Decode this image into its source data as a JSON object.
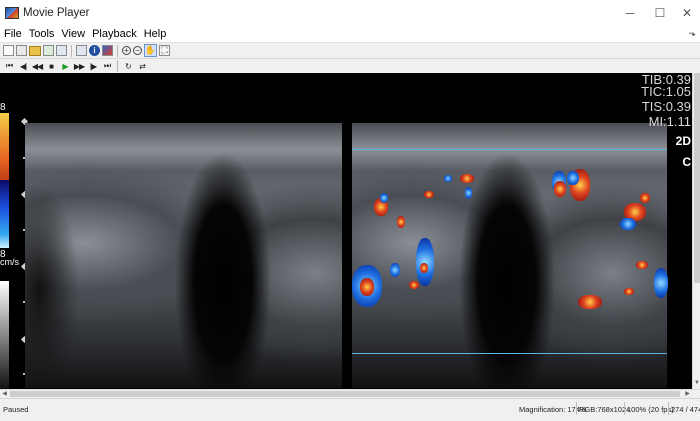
{
  "window": {
    "title": "Movie Player",
    "controls": {
      "minimize": "─",
      "maximize": "☐",
      "close": "✕"
    }
  },
  "menu": {
    "items": [
      "File",
      "Tools",
      "View",
      "Playback",
      "Help"
    ],
    "pin_glyph": "⬎"
  },
  "toolbar": {
    "icons": [
      "new-icon",
      "print-icon",
      "open-folder-icon",
      "export-icon",
      "save-frame-icon",
      "copy-icon",
      "info-icon",
      "colormap-icon",
      "zoom-in-icon",
      "zoom-out-icon",
      "pan-hand-icon",
      "fit-window-icon"
    ]
  },
  "playback": {
    "buttons": [
      {
        "name": "go-to-first-frame-button",
        "glyph": "⏮"
      },
      {
        "name": "step-back-button",
        "glyph": "◀|"
      },
      {
        "name": "rewind-button",
        "glyph": "◀◀"
      },
      {
        "name": "stop-button",
        "glyph": "■"
      },
      {
        "name": "play-button",
        "glyph": "▶"
      },
      {
        "name": "fast-forward-button",
        "glyph": "▶▶"
      },
      {
        "name": "step-forward-button",
        "glyph": "|▶"
      },
      {
        "name": "go-to-last-frame-button",
        "glyph": "⏭"
      },
      {
        "name": "loop-button",
        "glyph": "↻"
      },
      {
        "name": "playback-direction-button",
        "glyph": "⇄"
      }
    ]
  },
  "overlay": {
    "tib": "TIB:0.39",
    "tic": "TIC:1.05",
    "tis": "TIS:0.39",
    "mi": "MI:1.11",
    "mode_2d": "2D",
    "mode_c": "C",
    "scale_top": "8",
    "scale_bottom": "8",
    "scale_unit": "cm/s"
  },
  "status": {
    "state": "Paused",
    "magnification": "Magnification: 174%",
    "image_info": "RGB:768x1024",
    "rate": "100% (20 fps)",
    "frame": "274 / 474"
  },
  "colors": {
    "doppler_box_line": "#5ab8e6",
    "play_green": "#1a9a22",
    "background": "#000000"
  }
}
